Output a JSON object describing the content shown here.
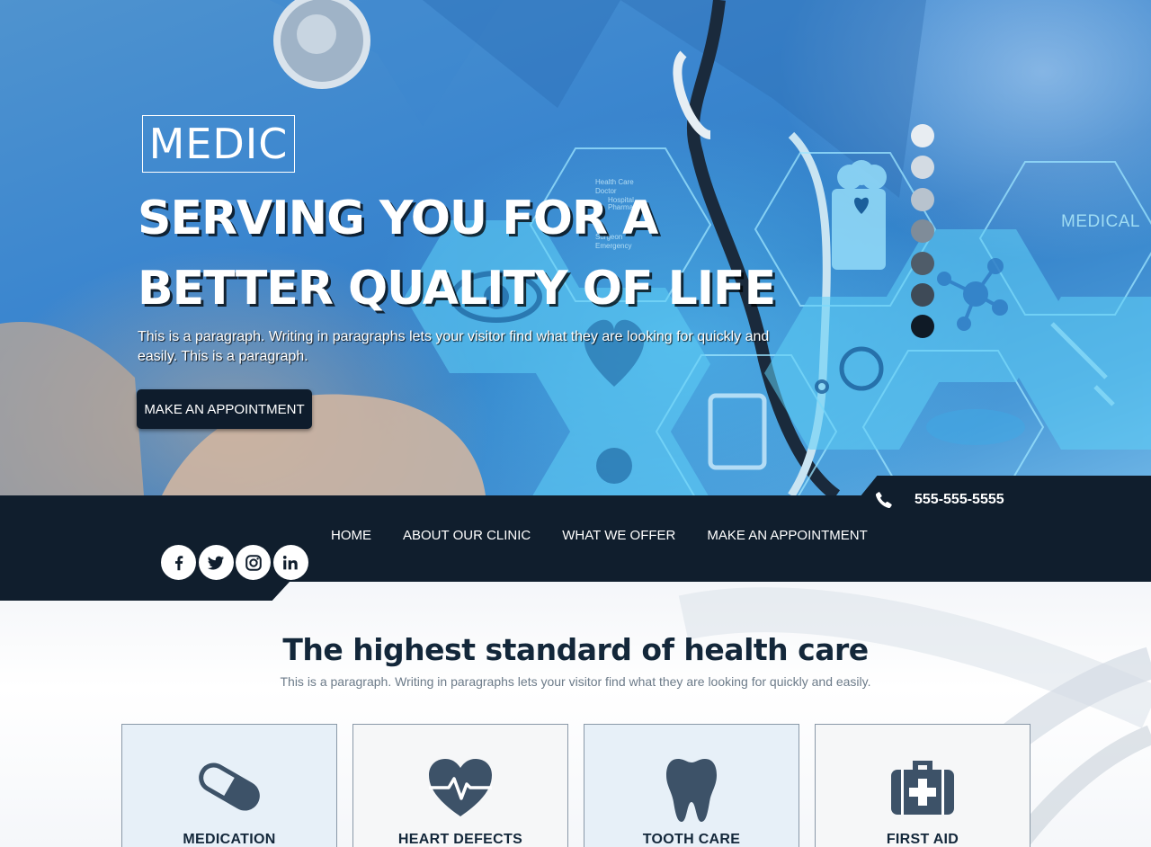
{
  "hero": {
    "logo": "MEDIC",
    "title_line1": "SERVING YOU FOR A",
    "title_line2": "BETTER QUALITY OF LIFE",
    "paragraph": "This is a paragraph. Writing in paragraphs lets your visitor find what they are looking for quickly and easily. This is a paragraph.",
    "cta_label": "MAKE AN APPOINTMENT",
    "medical_label": "MEDICAL",
    "slider_dots": [
      "#e8edf2",
      "#d3dbe3",
      "#b8c3ce",
      "#7f8c99",
      "#4f5c69",
      "#3e4a57",
      "#0f1a26"
    ]
  },
  "nav": {
    "phone": "555-555-5555",
    "links": [
      "HOME",
      "ABOUT OUR CLINIC",
      "WHAT WE OFFER",
      "MAKE AN APPOINTMENT"
    ],
    "socials": [
      "facebook-icon",
      "twitter-icon",
      "instagram-icon",
      "linkedin-icon"
    ]
  },
  "section": {
    "title": "The highest standard of health care",
    "subtitle": "This is a paragraph. Writing in paragraphs lets your visitor find what they are looking for quickly and easily."
  },
  "services": [
    {
      "title": "MEDICATION",
      "icon": "pill-icon",
      "background": "#e7f0f8"
    },
    {
      "title": "HEART DEFECTS",
      "icon": "heartbeat-icon",
      "background": "#f6f7f8"
    },
    {
      "title": "TOOTH CARE",
      "icon": "tooth-icon",
      "background": "#e7f0f8"
    },
    {
      "title": "FIRST AID",
      "icon": "first-aid-kit-icon",
      "background": "#f6f7f8"
    }
  ],
  "colors": {
    "navy": "#101e2d",
    "icon": "#3d5268",
    "hero_blue": "#3b86cf"
  }
}
